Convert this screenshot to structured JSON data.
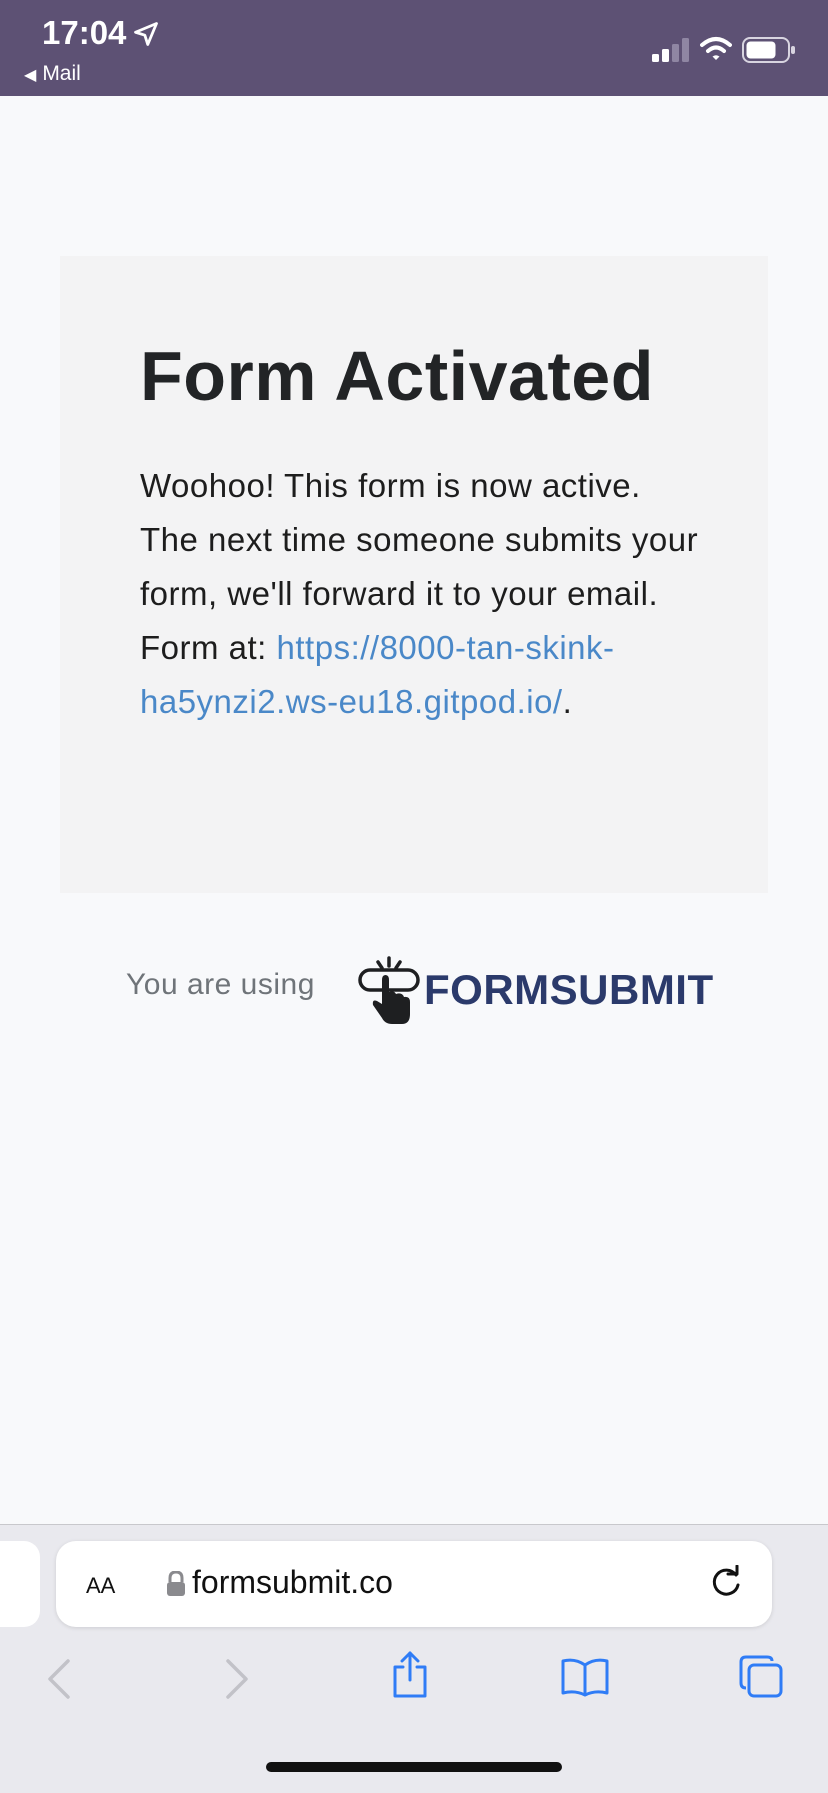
{
  "status_bar": {
    "time": "17:04",
    "back_app": "Mail",
    "bg_color": "#5d5174"
  },
  "card": {
    "title": "Form Activated",
    "body_text": "Woohoo! This form is now active. The next time someone submits your form, we'll forward it to your email. Form at: ",
    "form_url": "https://8000-tan-skink-ha5ynzi2.ws-eu18.gitpod.io/",
    "trailing": "."
  },
  "footer": {
    "using_label": "You are using",
    "brand_name": "FORMSUBMIT"
  },
  "browser": {
    "aa_label": "AA",
    "url_display": "formsubmit.co",
    "icons": [
      "lock-icon",
      "reload-icon",
      "back-icon",
      "forward-icon",
      "share-icon",
      "bookmarks-icon",
      "tabs-icon"
    ]
  },
  "colors": {
    "link": "#4a88c8",
    "brand": "#2b3a6b",
    "icon_blue": "#2f7cf6"
  }
}
